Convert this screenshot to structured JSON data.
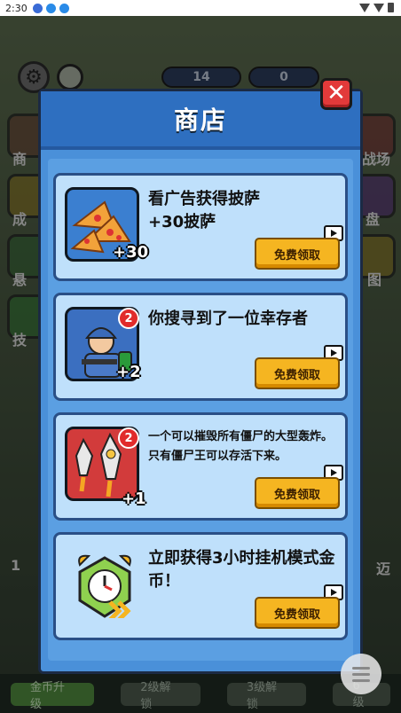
{
  "status_bar": {
    "time": "2:30"
  },
  "hud": {
    "pizza_count": "14",
    "coin_count": "0"
  },
  "side_labels": [
    "商",
    "成",
    "悬",
    "技",
    "战场",
    "盘",
    "图"
  ],
  "bottom_tabs": [
    "金币升级",
    "2级解锁",
    "3级解锁",
    "6级"
  ],
  "level_badges": [
    "1",
    "迈"
  ],
  "shop": {
    "title": "商店",
    "close_icon": "close-icon",
    "items": [
      {
        "description": "看广告获得披萨\n+30披萨",
        "count": "+30",
        "badge": "",
        "claim_label": "免费领取",
        "icon": "pizza-icon"
      },
      {
        "description": "你搜寻到了一位幸存者",
        "count": "+2",
        "badge": "2",
        "claim_label": "免费领取",
        "icon": "survivor-icon"
      },
      {
        "description": "一个可以摧毁所有僵尸的大型轰炸。只有僵尸王可以存活下来。",
        "count": "+1",
        "badge": "2",
        "claim_label": "免费领取",
        "icon": "rocket-icon"
      },
      {
        "description": "立即获得3小时挂机模式金币！",
        "count": "",
        "badge": "",
        "claim_label": "免费领取",
        "icon": "alarm-clock-icon"
      }
    ]
  },
  "colors": {
    "panel": "#4a90d9",
    "card": "#bfe0fb",
    "claim": "#f5b521",
    "close": "#e23a3a"
  }
}
